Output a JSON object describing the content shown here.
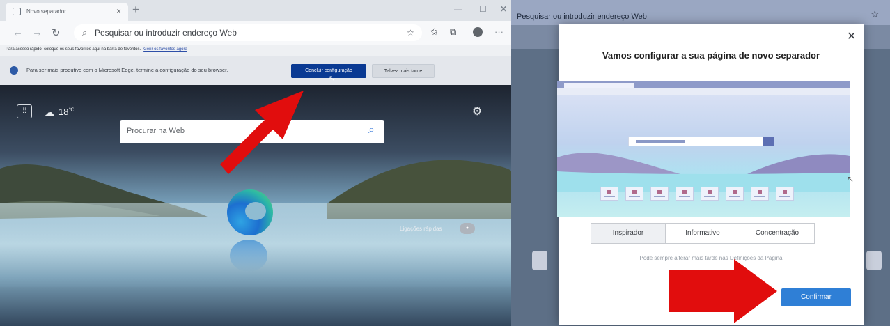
{
  "left_browser": {
    "tab_title": "Novo separador",
    "address_placeholder": "Pesquisar ou introduzir endereço Web",
    "favorites_bar": {
      "text": "Para acesso rápido, coloque os seus favoritos aqui na barra de favoritos.",
      "link": "Gerir os favoritos agora"
    },
    "infobar": {
      "message": "Para ser mais produtivo com o Microsoft Edge, termine a configuração do seu browser.",
      "primary_button": "Concluir configuração",
      "secondary_button": "Talvez mais tarde"
    },
    "new_tab_page": {
      "temperature": "18",
      "temperature_unit": "℃",
      "search_placeholder": "Procurar na Web",
      "quick_links_label": "Ligações rápidas"
    }
  },
  "right_panel": {
    "address_placeholder": "Pesquisar ou introduzir endereço Web",
    "modal": {
      "title": "Vamos configurar a sua página de novo separador",
      "layout_options": [
        "Inspirador",
        "Informativo",
        "Concentração"
      ],
      "selected_option": "Inspirador",
      "hint": "Pode sempre alterar mais tarde nas Definições da Página",
      "confirm_button": "Confirmar"
    }
  },
  "colors": {
    "primary_button": "#0a3a93",
    "confirm_button": "#2f7fd6",
    "annotation_arrow": "#e10d0d"
  },
  "icons": [
    "tab-icon",
    "close-icon",
    "new-tab-icon",
    "back-icon",
    "forward-icon",
    "refresh-icon",
    "search-icon",
    "favorite-star-icon",
    "favorites-icon",
    "collections-icon",
    "profile-icon",
    "more-icon",
    "edge-icon",
    "apps-grid-icon",
    "weather-cloud-icon",
    "settings-gear-icon",
    "edge-logo",
    "cursor-icon"
  ]
}
